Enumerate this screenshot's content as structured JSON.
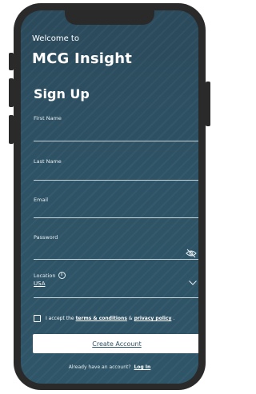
{
  "header": {
    "welcome": "Welcome to",
    "app_name": "MCG Insight",
    "form_title": "Sign Up"
  },
  "form": {
    "first_name_label": "First Name",
    "last_name_label": "Last Name",
    "email_label": "Email",
    "password_label": "Password",
    "location_label": "Location",
    "location_value": "USA"
  },
  "terms": {
    "prefix": "I accept the",
    "terms_link": "terms & conditions",
    "joiner": "&",
    "privacy_link": "privacy policy",
    "suffix": "."
  },
  "actions": {
    "create_label": "Create Account",
    "login_prompt": "Already have an account?",
    "login_link": "Log In"
  },
  "colors": {
    "background": "#2e5366",
    "frame": "#2a2a2a",
    "button": "#ffffff"
  }
}
